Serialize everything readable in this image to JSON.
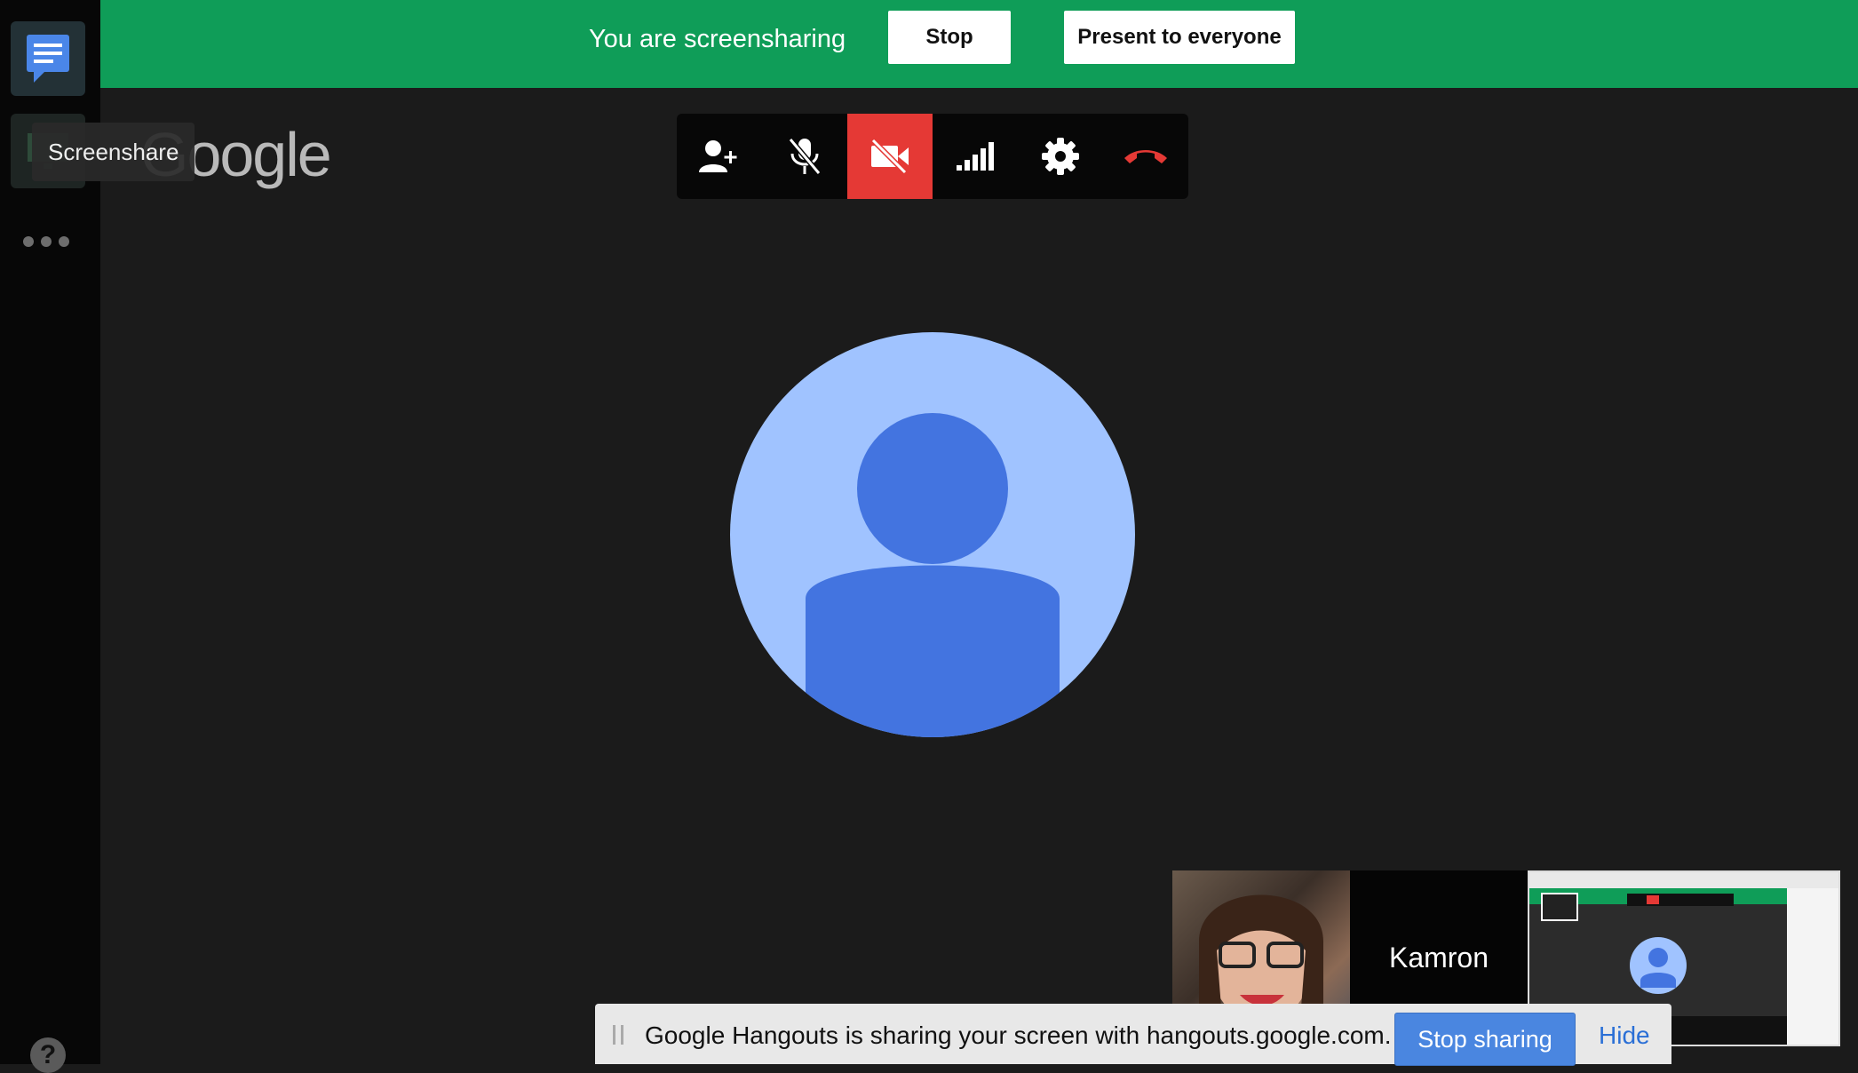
{
  "topbar": {
    "status_text": "You are screensharing",
    "stop_label": "Stop",
    "present_label": "Present to everyone",
    "bg_color": "#0f9d58"
  },
  "sidebar": {
    "items": [
      {
        "name": "chat",
        "icon": "chat-icon"
      },
      {
        "name": "screenshare",
        "icon": "screenshare-icon",
        "tooltip": "Screenshare"
      }
    ],
    "more_icon": "more-dots-icon",
    "help_label": "?"
  },
  "logo": {
    "text": "Google"
  },
  "controls": [
    {
      "name": "add-person",
      "icon": "add-person-icon",
      "active": false
    },
    {
      "name": "mic",
      "icon": "mic-off-icon",
      "active": false
    },
    {
      "name": "camera",
      "icon": "video-off-icon",
      "active": true
    },
    {
      "name": "signal",
      "icon": "signal-icon",
      "active": false
    },
    {
      "name": "settings",
      "icon": "gear-icon",
      "active": false
    },
    {
      "name": "hangup",
      "icon": "hangup-icon",
      "active": false
    }
  ],
  "filmstrip": {
    "participant_name": "Kamron"
  },
  "notification": {
    "text": "Google Hangouts is sharing your screen with hangouts.google.com.",
    "stop_label": "Stop sharing",
    "hide_label": "Hide"
  },
  "colors": {
    "avatar_bg": "#a0c3ff",
    "avatar_fg": "#4374e0",
    "danger": "#e53935"
  }
}
